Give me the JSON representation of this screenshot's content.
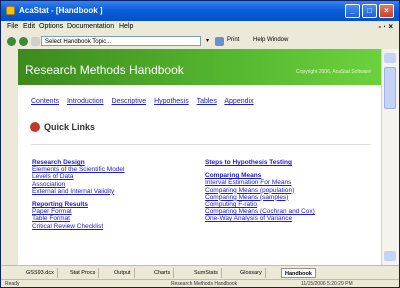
{
  "window": {
    "title": "AcaStat - [Handbook ]"
  },
  "menubar": {
    "items": [
      "File",
      "Edit",
      "Options",
      "Documentation",
      "Help"
    ],
    "right": "- · ×"
  },
  "toolbar": {
    "topic_placeholder": "Select Handbook Topic...",
    "print": "Print",
    "help_window": "Help Window"
  },
  "page": {
    "header_title": "Research Methods Handbook",
    "header_copyright": "Copyright 2006, AcaStat Software",
    "nav": [
      "Contents",
      "Introduction",
      "Descriptive",
      "Hypothesis",
      "Tables",
      "Appendix"
    ],
    "quick_links": "Quick Links",
    "left": {
      "group1": [
        "Research Design",
        "Elements of the Scientific Model",
        "Levels of Data",
        "Association",
        "External and Internal Validity"
      ],
      "group2_heading": "Reporting Results",
      "group2": [
        "Paper Format",
        "Table Format",
        "Critical Review Checklist"
      ]
    },
    "right": {
      "heading": "Steps to Hypothesis Testing",
      "group_heading": "Comparing Means",
      "group": [
        "Interval Estimation For Means",
        "Comparing Means (population)",
        "Comparing Means (samples)",
        "Computing F-ratio",
        "Comparing Means (Cochran and Cox)",
        "One-Way Analysis of Variance"
      ]
    }
  },
  "tabs": [
    "GSS93.dcx",
    "Stat Procs",
    "Output",
    "Charts",
    "SumStats",
    "Glossary",
    "Handbook"
  ],
  "status": {
    "left": "Ready",
    "middle": "Research Methods Handbook",
    "right": "11/15/2006 5:20:29 PM"
  },
  "colors": {
    "header_green": "#4caf2a",
    "link_blue": "#1b1bd6",
    "titlebar_blue": "#0a5fd8"
  }
}
